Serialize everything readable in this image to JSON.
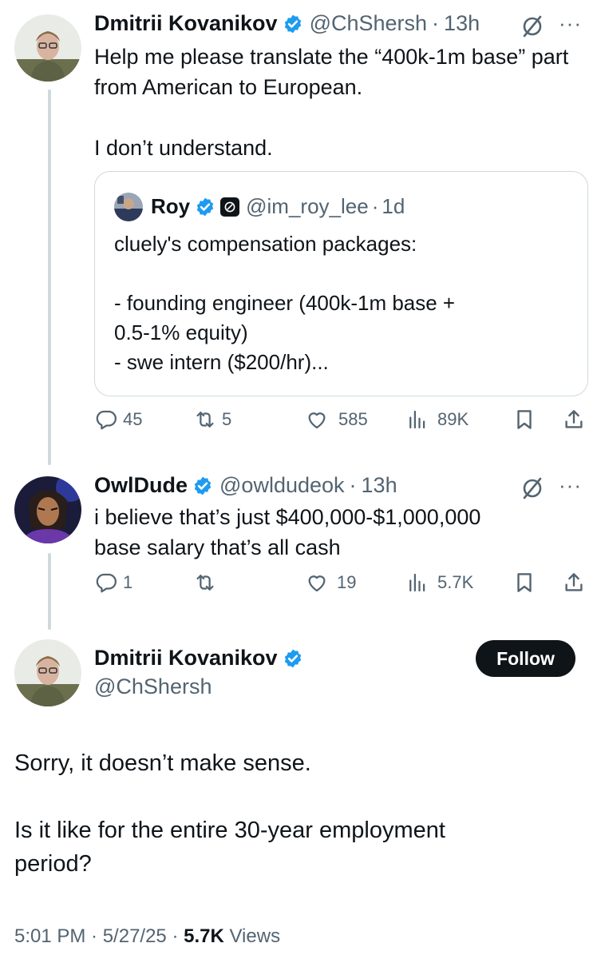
{
  "tweet1": {
    "name": "Dmitrii Kovanikov",
    "handle": "@ChShersh",
    "time": "13h",
    "text": "Help me please translate the “400k-1m base” part from American to European.\n\nI don’t understand.",
    "quote": {
      "name": "Roy",
      "handle": "@im_roy_lee",
      "time": "1d",
      "text": "cluely's compensation packages:\n\n- founding engineer (400k-1m base +\n0.5-1% equity)\n- swe intern ($200/hr)..."
    },
    "replies": "45",
    "reposts": "5",
    "likes": "585",
    "views": "89K"
  },
  "tweet2": {
    "name": "OwlDude",
    "handle": "@owldudeok",
    "time": "13h",
    "text": "i believe that’s just $400,000-$1,000,000\nbase salary that’s all cash",
    "replies": "1",
    "reposts": "",
    "likes": "19",
    "views": "5.7K"
  },
  "main": {
    "name": "Dmitrii Kovanikov",
    "handle": "@ChShersh",
    "follow_label": "Follow",
    "text": "Sorry, it doesn’t make sense.\n\nIs it like for the entire 30-year employment\nperiod?",
    "timestamp": "5:01 PM · 5/27/25 · ",
    "views_count": "5.7K",
    "views_label": " Views"
  },
  "icons": {
    "separator": "·",
    "more": "···"
  },
  "colors": {
    "verified": "#1d9bf0",
    "secondary_text": "#536471",
    "thread_line": "#cfd9de",
    "follow_bg": "#0f1419"
  }
}
